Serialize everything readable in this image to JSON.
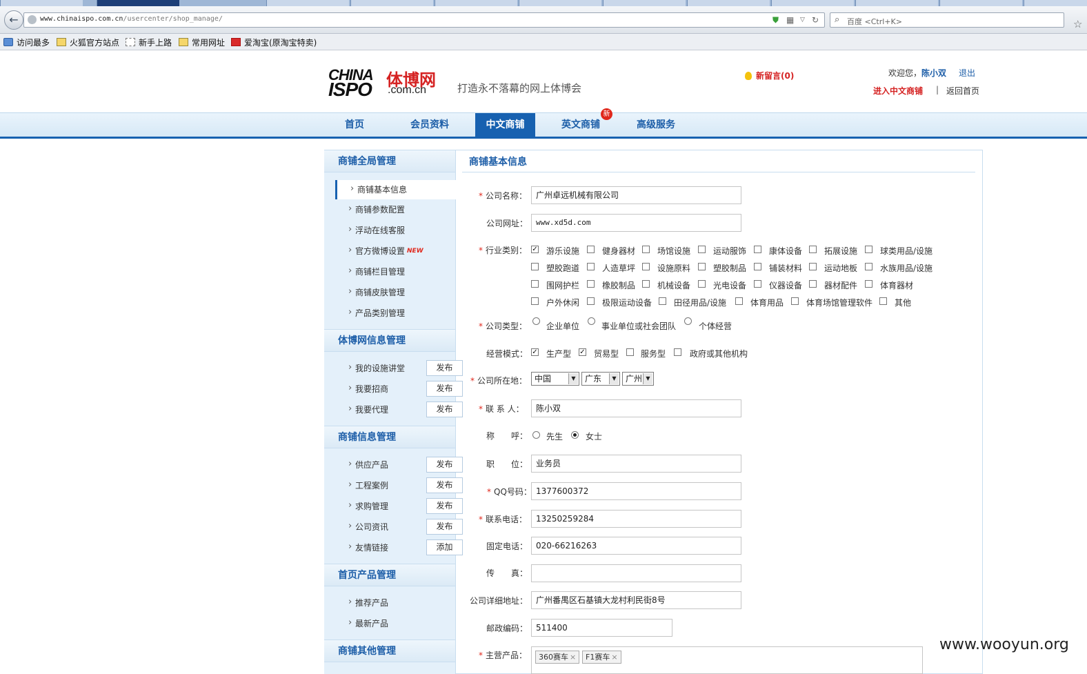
{
  "browser": {
    "url_host": "www.chinaispo.com.cn",
    "url_path": "/usercenter/shop_manage/",
    "search_placeholder": "百度 <Ctrl+K>",
    "bookmarks": [
      "访问最多",
      "火狐官方站点",
      "新手上路",
      "常用网址",
      "爱淘宝(原淘宝特卖)"
    ]
  },
  "header": {
    "logo_en_top": "CHINA",
    "logo_en_bottom": "ISPO",
    "logo_cn": "体博网",
    "logo_domain": ".com.cn",
    "slogan": "打造永不落幕的网上体博会",
    "new_message": "新留言(0)",
    "welcome_prefix": "欢迎您，",
    "username": "陈小双",
    "logout": "退出",
    "enter_shop": "进入中文商铺",
    "separator": "|",
    "back_home": "返回首页"
  },
  "nav": {
    "items": [
      "首页",
      "会员资料",
      "中文商铺",
      "英文商铺",
      "高级服务"
    ],
    "active": "中文商铺",
    "badge": "新"
  },
  "sidebar": {
    "sections": [
      {
        "title": "商铺全局管理"
      },
      {
        "title": "体博网信息管理"
      },
      {
        "title": "商铺信息管理"
      },
      {
        "title": "首页产品管理"
      },
      {
        "title": "商铺其他管理"
      }
    ],
    "global": [
      "商铺基本信息",
      "商铺参数配置",
      "浮动在线客服",
      "官方微博设置",
      "商铺栏目管理",
      "商铺皮肤管理",
      "产品类别管理"
    ],
    "new_tag": "NEW",
    "ispo": [
      {
        "label": "我的设施讲堂",
        "btn": "发布"
      },
      {
        "label": "我要招商",
        "btn": "发布"
      },
      {
        "label": "我要代理",
        "btn": "发布"
      }
    ],
    "shop": [
      {
        "label": "供应产品",
        "btn": "发布"
      },
      {
        "label": "工程案例",
        "btn": "发布"
      },
      {
        "label": "求购管理",
        "btn": "发布"
      },
      {
        "label": "公司资讯",
        "btn": "发布"
      },
      {
        "label": "友情链接",
        "btn": "添加"
      }
    ],
    "home": [
      "推荐产品",
      "最新产品"
    ]
  },
  "form": {
    "title": "商铺基本信息",
    "req": "*",
    "labels": {
      "company_name": "公司名称：",
      "website": "公司网址：",
      "industry": "行业类别：",
      "company_type": "公司类型：",
      "business_mode": "经营模式：",
      "location": "公司所在地：",
      "contact": "联 系 人：",
      "salutation": "称　　呼：",
      "position": "职　　位：",
      "qq": "QQ号码：",
      "phone": "联系电话：",
      "landline": "固定电话：",
      "fax": "传　　真：",
      "address": "公司详细地址：",
      "zip": "邮政编码：",
      "products": "主营产品："
    },
    "values": {
      "company_name": "广州卓远机械有限公司",
      "website": "www.xd5d.com",
      "contact": "陈小双",
      "position": "业务员",
      "qq": "1377600372",
      "phone": "13250259284",
      "landline": "020-66216263",
      "fax": "",
      "address": "广州番禺区石基镇大龙村利民街8号",
      "zip": "511400"
    },
    "industry_rows": [
      [
        "游乐设施",
        "健身器材",
        "场馆设施",
        "运动服饰",
        "康体设备",
        "拓展设施",
        "球类用品/设施"
      ],
      [
        "塑胶跑道",
        "人造草坪",
        "设施原料",
        "塑胶制品",
        "铺装材料",
        "运动地板",
        "水族用品/设施"
      ],
      [
        "围网护栏",
        "橡胶制品",
        "机械设备",
        "光电设备",
        "仪器设备",
        "器材配件",
        "体育器材"
      ],
      [
        "户外休闲",
        "极限运动设备",
        "田径用品/设施",
        "体育用品",
        "体育场馆管理软件",
        "其他"
      ]
    ],
    "industry_checked": "游乐设施",
    "check_mark": "✓",
    "company_types": [
      "企业单位",
      "事业单位或社会团队",
      "个体经营"
    ],
    "business_modes": [
      "生产型",
      "贸易型",
      "服务型",
      "政府或其他机构"
    ],
    "location": {
      "country": "中国",
      "province": "广东",
      "city": "广州"
    },
    "select_arrow": "▼",
    "salutations": [
      "先生",
      "女士"
    ],
    "salutation_selected": "女士",
    "product_tags": [
      "360赛车",
      "F1赛车"
    ],
    "tag_remove": "×"
  },
  "watermark": "www.wooyun.org"
}
